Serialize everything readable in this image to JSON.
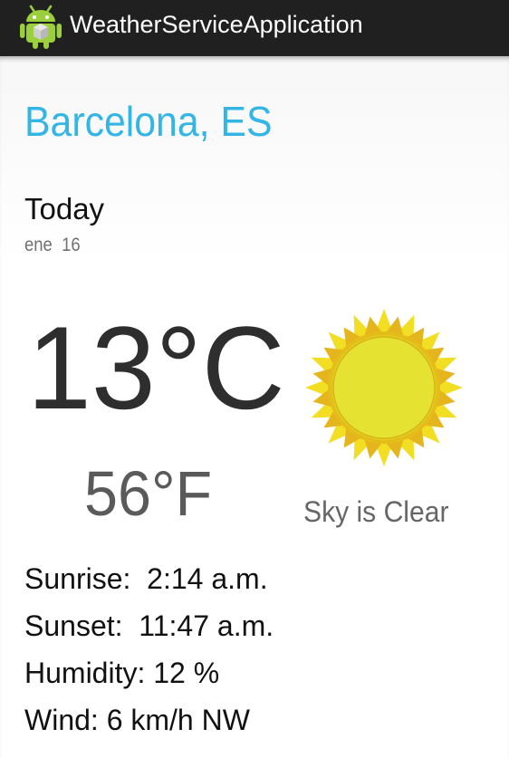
{
  "app": {
    "title": "WeatherServiceApplication",
    "icon": "android-icon"
  },
  "location": {
    "city": "Barcelona, ES"
  },
  "forecast": {
    "day_label": "Today",
    "date": "ene  16",
    "temp_c": "13°C",
    "temp_f": "56°F",
    "condition": "Sky is Clear",
    "condition_icon": "sun-icon"
  },
  "details": {
    "sunrise": "Sunrise:  2:14 a.m.",
    "sunset": "Sunset:  11:47 a.m.",
    "humidity": "Humidity: 12 %",
    "wind": "Wind: 6 km/h NW"
  },
  "colors": {
    "action_bar": "#202020",
    "accent": "#33b5e5",
    "sun_outer": "#f0d21e",
    "sun_core": "#e8e230"
  }
}
